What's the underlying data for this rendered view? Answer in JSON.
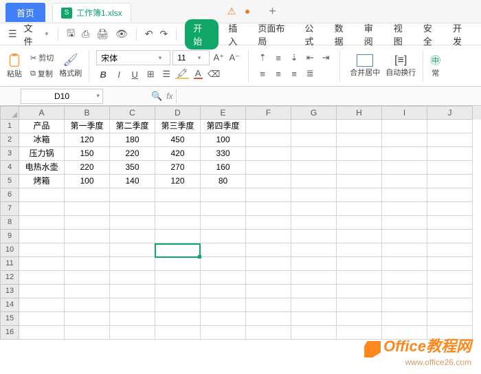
{
  "titlebar": {
    "home": "首页",
    "tab_icon": "S",
    "tab_name": "工作簿1.xlsx",
    "warn": "⚠",
    "plus": "+"
  },
  "menubar": {
    "file": "文件",
    "start": "开始",
    "items": [
      "插入",
      "页面布局",
      "公式",
      "数据",
      "审阅",
      "视图",
      "安全",
      "开发"
    ]
  },
  "ribbon": {
    "paste": "粘贴",
    "cut": "剪切",
    "copy": "复制",
    "brush": "格式刷",
    "font": "宋体",
    "size": "11",
    "merge": "合并居中",
    "wrap": "自动换行",
    "curr": "常"
  },
  "namebox": "D10",
  "fx": "fx",
  "cols": [
    "A",
    "B",
    "C",
    "D",
    "E",
    "F",
    "G",
    "H",
    "I",
    "J"
  ],
  "rows": [
    "1",
    "2",
    "3",
    "4",
    "5",
    "6",
    "7",
    "8",
    "9",
    "10",
    "11",
    "12",
    "13",
    "14",
    "15",
    "16"
  ],
  "chart_data": {
    "type": "table",
    "headers": [
      "产品",
      "第一季度",
      "第二季度",
      "第三季度",
      "第四季度"
    ],
    "data": [
      [
        "冰箱",
        120,
        180,
        450,
        100
      ],
      [
        "压力锅",
        150,
        220,
        420,
        330
      ],
      [
        "电热水壶",
        220,
        350,
        270,
        160
      ],
      [
        "烤箱",
        100,
        140,
        120,
        80
      ]
    ]
  },
  "watermark": {
    "title": "Office教程网",
    "url": "www.office26.com"
  }
}
